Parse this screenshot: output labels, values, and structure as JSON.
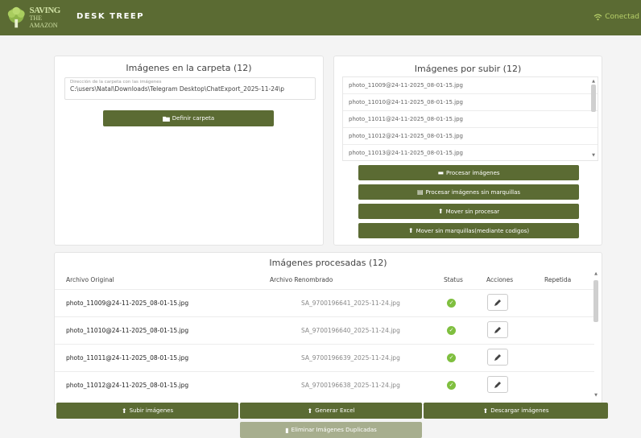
{
  "header": {
    "logo_line1": "SAVING",
    "logo_line2": "THE AMAZON",
    "app_title": "DESK TREEP",
    "status_text": "Conectad"
  },
  "folder_panel": {
    "title": "Imágenes en la carpeta (12)",
    "path_caption": "Dirección de la carpeta con las imágenes",
    "path_value": "C:\\users\\Natal\\Downloads\\Telegram Desktop\\ChatExport_2025-11-24\\p",
    "define_button": "Definir carpeta"
  },
  "upload_panel": {
    "title": "Imágenes por subir (12)",
    "items": [
      "photo_11009@24-11-2025_08-01-15.jpg",
      "photo_11010@24-11-2025_08-01-15.jpg",
      "photo_11011@24-11-2025_08-01-15.jpg",
      "photo_11012@24-11-2025_08-01-15.jpg",
      "photo_11013@24-11-2025_08-01-15.jpg"
    ],
    "buttons": {
      "process": "Procesar imágenes",
      "process_no_marks": "Procesar imágenes sin marquillas",
      "move_no_process": "Mover sin procesar",
      "move_no_marks": "Mover sin marquillas(mediante codigos)"
    }
  },
  "processed_panel": {
    "title": "Imágenes procesadas (12)",
    "columns": {
      "original": "Archivo Original",
      "renamed": "Archivo Renombrado",
      "status": "Status",
      "actions": "Acciones",
      "repeated": "Repetida"
    },
    "rows": [
      {
        "original": "photo_11009@24-11-2025_08-01-15.jpg",
        "renamed": "SA_9700196641_2025-11-24.jpg"
      },
      {
        "original": "photo_11010@24-11-2025_08-01-15.jpg",
        "renamed": "SA_9700196640_2025-11-24.jpg"
      },
      {
        "original": "photo_11011@24-11-2025_08-01-15.jpg",
        "renamed": "SA_9700196639_2025-11-24.jpg"
      },
      {
        "original": "photo_11012@24-11-2025_08-01-15.jpg",
        "renamed": "SA_9700196638_2025-11-24.jpg"
      }
    ]
  },
  "footer": {
    "upload": "Subir imágenes",
    "excel": "Generar Excel",
    "download": "Descargar imágenes",
    "delete_duplicates": "Eliminar Imágenes Duplicadas"
  },
  "colors": {
    "brand": "#5b6b33",
    "ok": "#7fbf3f"
  }
}
